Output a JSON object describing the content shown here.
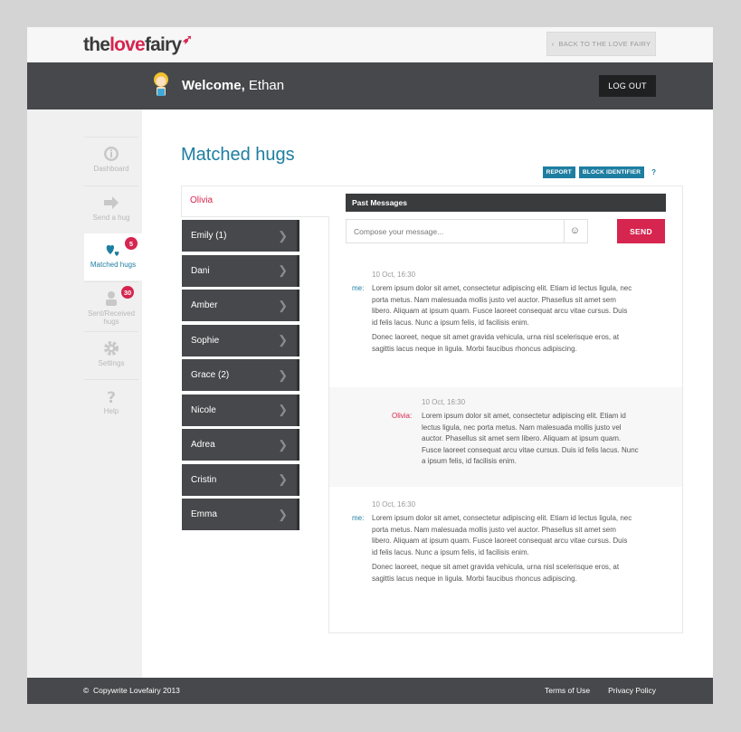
{
  "header": {
    "logo_the": "the",
    "logo_love": "love",
    "logo_fairy": "fairy",
    "back_label": "BACK TO THE LOVE FAIRY"
  },
  "welcome": {
    "greeting": "Welcome,",
    "name": "Ethan",
    "logout_label": "LOG OUT"
  },
  "sidebar": {
    "items": [
      {
        "label": "Dashboard",
        "icon": "info-icon"
      },
      {
        "label": "Send a hug",
        "icon": "arrow-right-icon"
      },
      {
        "label": "Matched hugs",
        "icon": "hearts-icon",
        "badge": "5"
      },
      {
        "label": "Sent/Received hugs",
        "icon": "person-icon",
        "badge": "30"
      },
      {
        "label": "Settings",
        "icon": "gear-icon"
      },
      {
        "label": "Help",
        "icon": "question-icon"
      }
    ]
  },
  "main": {
    "title": "Matched hugs",
    "report_label": "REPORT",
    "block_label": "BLOCK IDENTIFIER",
    "help_label": "?",
    "active_contact": "Olivia",
    "contacts": [
      "Emily (1)",
      "Dani",
      "Amber",
      "Sophie",
      "Grace (2)",
      "Nicole",
      "Adrea",
      "Cristin",
      "Emma"
    ],
    "past_messages_label": "Past Messages",
    "compose_placeholder": "Compose your message...",
    "send_label": "SEND",
    "messages": [
      {
        "time": "10 Oct, 16:30",
        "sender": "me:",
        "p1": "Lorem ipsum dolor sit amet, consectetur adipiscing elit. Etiam id lectus ligula, nec porta metus. Nam malesuada mollis justo vel auctor. Phasellus sit amet sem libero. Aliquam at ipsum quam. Fusce laoreet consequat arcu vitae cursus. Duis id felis lacus. Nunc a ipsum felis, id facilisis enim.",
        "p2": "Donec laoreet, neque sit amet gravida vehicula, urna nisl scelerisque eros, at sagittis lacus neque in ligula. Morbi faucibus rhoncus adipiscing."
      },
      {
        "time": "10 Oct, 16:30",
        "sender": "Olivia:",
        "p1": "Lorem ipsum dolor sit amet, consectetur adipiscing elit. Etiam id lectus ligula, nec porta metus. Nam malesuada mollis justo vel auctor. Phasellus sit amet sem libero. Aliquam at ipsum quam. Fusce laoreet consequat arcu vitae cursus. Duis id felis lacus. Nunc a ipsum felis, id facilisis enim."
      },
      {
        "time": "10 Oct, 16:30",
        "sender": "me:",
        "p1": "Lorem ipsum dolor sit amet, consectetur adipiscing elit. Etiam id lectus ligula, nec porta metus. Nam malesuada mollis justo vel auctor. Phasellus sit amet sem libero. Aliquam at ipsum quam. Fusce laoreet consequat arcu vitae cursus. Duis id felis lacus. Nunc a ipsum felis, id facilisis enim.",
        "p2": "Donec laoreet, neque sit amet gravida vehicula, urna nisl scelerisque eros, at sagittis lacus neque in ligula. Morbi faucibus rhoncus adipiscing."
      }
    ]
  },
  "footer": {
    "copyright": "Copywrite Lovefairy 2013",
    "terms": "Terms of Use",
    "privacy": "Privacy Policy"
  },
  "colors": {
    "accent_blue": "#1e7ea1",
    "accent_pink": "#d6254f",
    "dark_bar": "#46484b"
  }
}
